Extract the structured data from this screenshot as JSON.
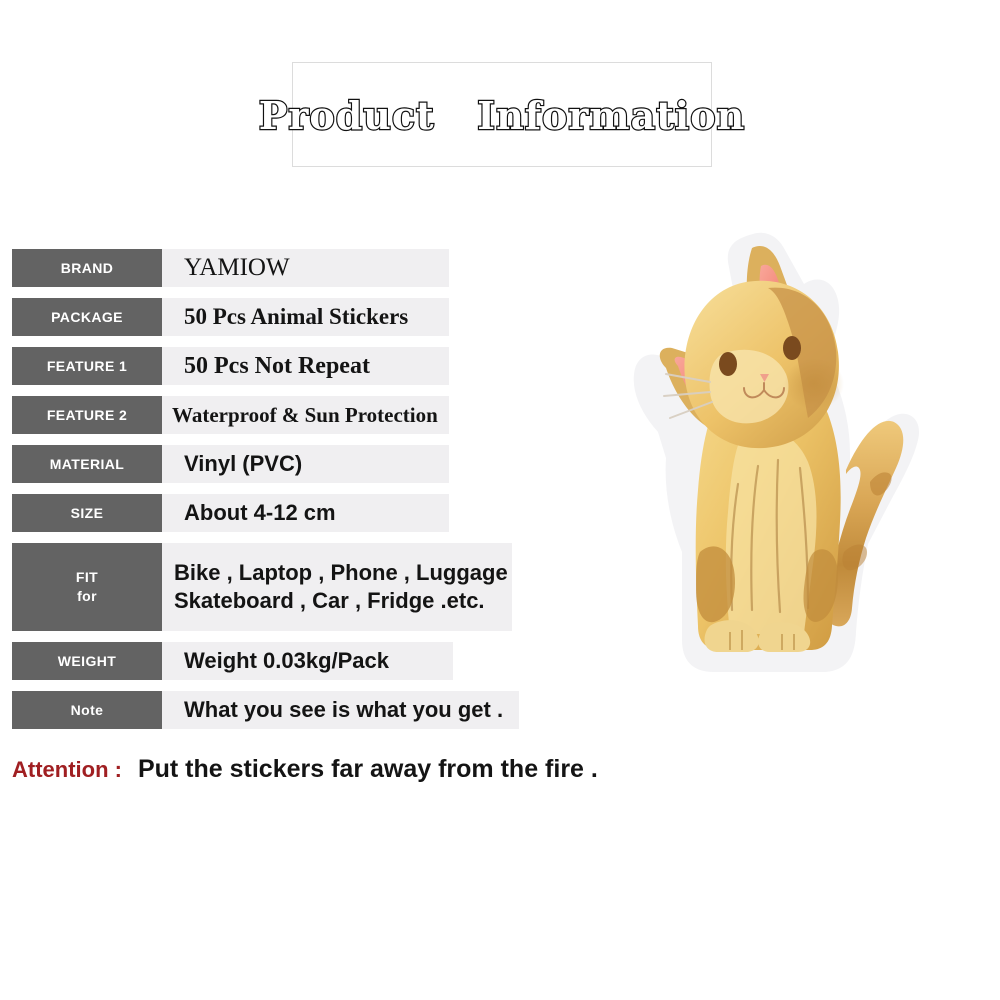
{
  "header": {
    "title": "Product   Information"
  },
  "spec_table": {
    "rows": [
      {
        "label": "BRAND",
        "value": "YAMIOW"
      },
      {
        "label": "PACKAGE",
        "value": "50 Pcs Animal Stickers"
      },
      {
        "label": "FEATURE 1",
        "value": "50 Pcs Not Repeat"
      },
      {
        "label": "FEATURE 2",
        "value": "Waterproof & Sun Protection"
      },
      {
        "label": "MATERIAL",
        "value": "Vinyl (PVC)"
      },
      {
        "label": "SIZE",
        "value": "About 4-12 cm"
      },
      {
        "label": "FIT",
        "label2": "for",
        "value": "Bike , Laptop , Phone , Luggage",
        "value2": "Skateboard , Car , Fridge .etc."
      },
      {
        "label": "WEIGHT",
        "value": "Weight 0.03kg/Pack"
      },
      {
        "label": "Note",
        "value": "What you see is what you get ."
      }
    ]
  },
  "attention": {
    "label": "Attention :",
    "text": "Put the stickers far away from the fire ."
  },
  "illustration": {
    "name": "ginger-kitten-sticker",
    "description": "Watercolor ginger kitten sitting, die-cut white sticker border"
  },
  "colors": {
    "label_bg": "#636363",
    "value_bg": "#f0eff1",
    "label_text": "#ffffff",
    "value_text": "#141414",
    "attention_accent": "#a01f22",
    "title_outline": "#111111",
    "title_fill": "#ffffff",
    "box_border": "#dcdcdc",
    "page_bg": "#ffffff",
    "cat_body_light": "#f2d27e",
    "cat_body_mid": "#e3b256",
    "cat_body_dark": "#c08a3a",
    "cat_ear_pink": "#f08070",
    "cat_eye": "#7a4a1e",
    "sticker_border": "#f2f2f4"
  }
}
